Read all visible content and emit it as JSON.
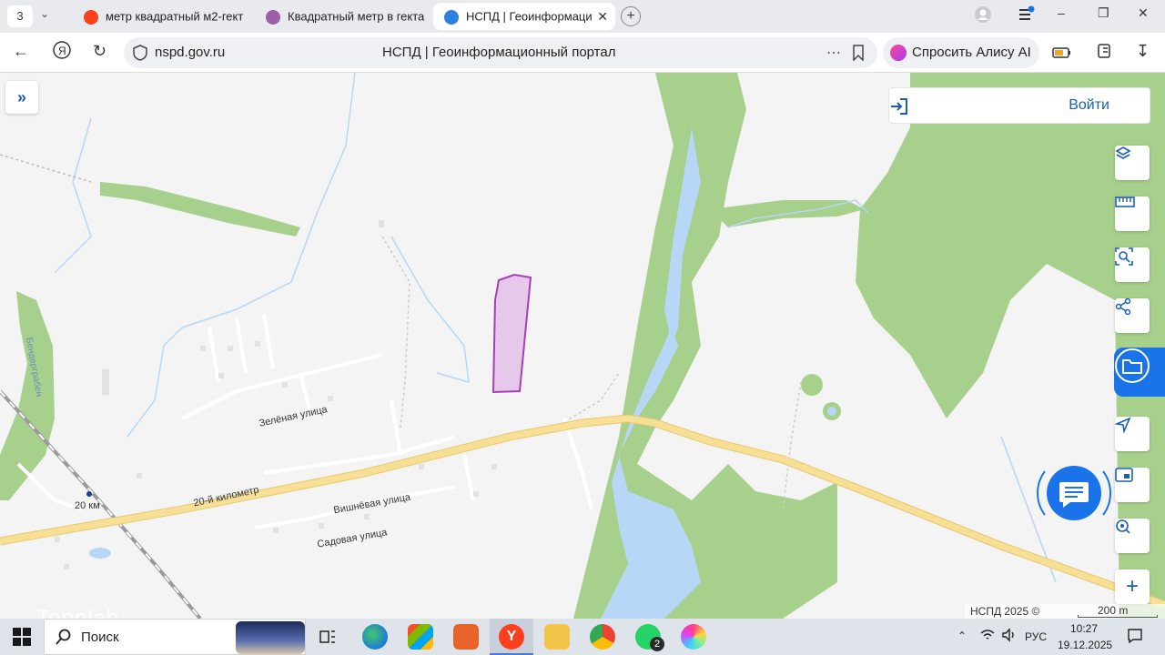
{
  "browser": {
    "tab_count": "3",
    "tabs": [
      {
        "title": "метр квадратный м2-гект",
        "favicon_color": "#fc3f1d"
      },
      {
        "title": "Квадратный метр в гекта",
        "favicon_color": "#9c5fa8"
      },
      {
        "title": "НСПД | Геоинформаци",
        "favicon_color": "#2a7fe0",
        "active": true
      }
    ],
    "url": "nspd.gov.ru",
    "page_title": "НСПД | Геоинформационный портал",
    "alice_label": "Спросить Алису AI"
  },
  "map": {
    "login_label": "Войти",
    "labels": {
      "road_name": "20-й километр",
      "street_1": "Зелёная улица",
      "street_2": "Вишнёвая улица",
      "street_3": "Садовая улица",
      "km_marker": "20 км",
      "canal": "Бендергрaбен"
    },
    "copyright": "НСПД 2025 ©",
    "scale_label": "200 m",
    "watermark": "Topnlab",
    "parcel_color": "#a43fb5",
    "water_color": "#b8d6f5",
    "forest_color": "#a8d08d",
    "road_color": "#f7df95"
  },
  "sidebar_icons": [
    "layers-icon",
    "ruler-icon",
    "select-area-icon",
    "share-icon",
    "folder-icon",
    "locate-icon",
    "picture-in-picture-icon",
    "search-location-icon",
    "zoom-in-icon"
  ],
  "taskbar": {
    "search_label": "Поиск",
    "lang": "РУС",
    "time": "10:27",
    "date": "19.12.2025",
    "whatsapp_badge": "2"
  }
}
